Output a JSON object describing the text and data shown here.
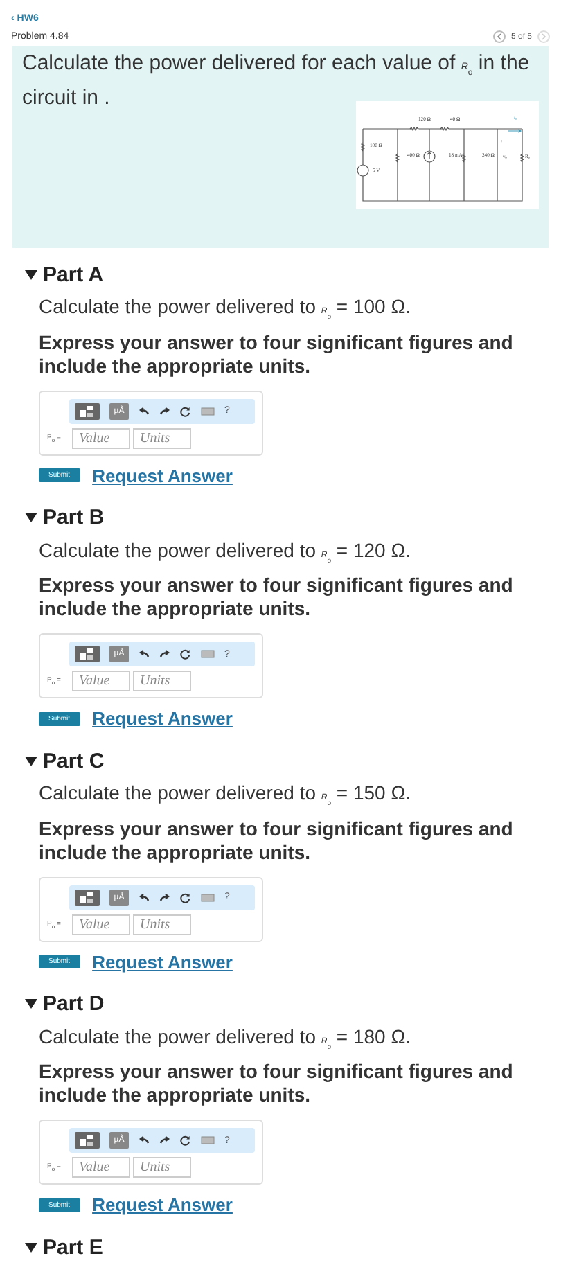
{
  "header": {
    "back_link": "‹ HW6",
    "title": "Problem 4.84",
    "pager": "5 of 5"
  },
  "problem": {
    "text": "Calculate the power delivered for each value of *R*$_{o}$ in the circuit in .",
    "circuit_labels": [
      "120 Ω",
      "40 Ω",
      "100 Ω",
      "5 V",
      "400 Ω",
      "18 mA",
      "240 Ω",
      "+",
      "vₒ",
      "−",
      "iₒ",
      "Rₒ"
    ]
  },
  "parts": [
    {
      "title": "Part A",
      "expanded": true,
      "prompt": "Calculate the power delivered to *R*$_{o}$ = 100 Ω.",
      "instruction": "Express your answer to four significant figures and include the appropriate units.",
      "toolbar": {
        "units_button": "µÅ",
        "help": "?"
      },
      "answer_label": "P$_{o}$ =",
      "value_placeholder": "Value",
      "units_placeholder": "Units",
      "submit": "Submit",
      "request": "Request Answer"
    },
    {
      "title": "Part B",
      "expanded": true,
      "prompt": "Calculate the power delivered to *R*$_{o}$ = 120 Ω.",
      "instruction": "Express your answer to four significant figures and include the appropriate units.",
      "toolbar": {
        "units_button": "µÅ",
        "help": "?"
      },
      "answer_label": "P$_{o}$ =",
      "value_placeholder": "Value",
      "units_placeholder": "Units",
      "submit": "Submit",
      "request": "Request Answer"
    },
    {
      "title": "Part C",
      "expanded": true,
      "prompt": "Calculate the power delivered to *R*$_{o}$ = 150 Ω.",
      "instruction": "Express your answer to four significant figures and include the appropriate units.",
      "toolbar": {
        "units_button": "µÅ",
        "help": "?"
      },
      "answer_label": "P$_{o}$ =",
      "value_placeholder": "Value",
      "units_placeholder": "Units",
      "submit": "Submit",
      "request": "Request Answer"
    },
    {
      "title": "Part D",
      "expanded": true,
      "prompt": "Calculate the power delivered to *R*$_{o}$ = 180 Ω.",
      "instruction": "Express your answer to four significant figures and include the appropriate units.",
      "toolbar": {
        "units_button": "µÅ",
        "help": "?"
      },
      "answer_label": "P$_{o}$ =",
      "value_placeholder": "Value",
      "units_placeholder": "Units",
      "submit": "Submit",
      "request": "Request Answer"
    },
    {
      "title": "Part E",
      "expanded": true
    }
  ]
}
